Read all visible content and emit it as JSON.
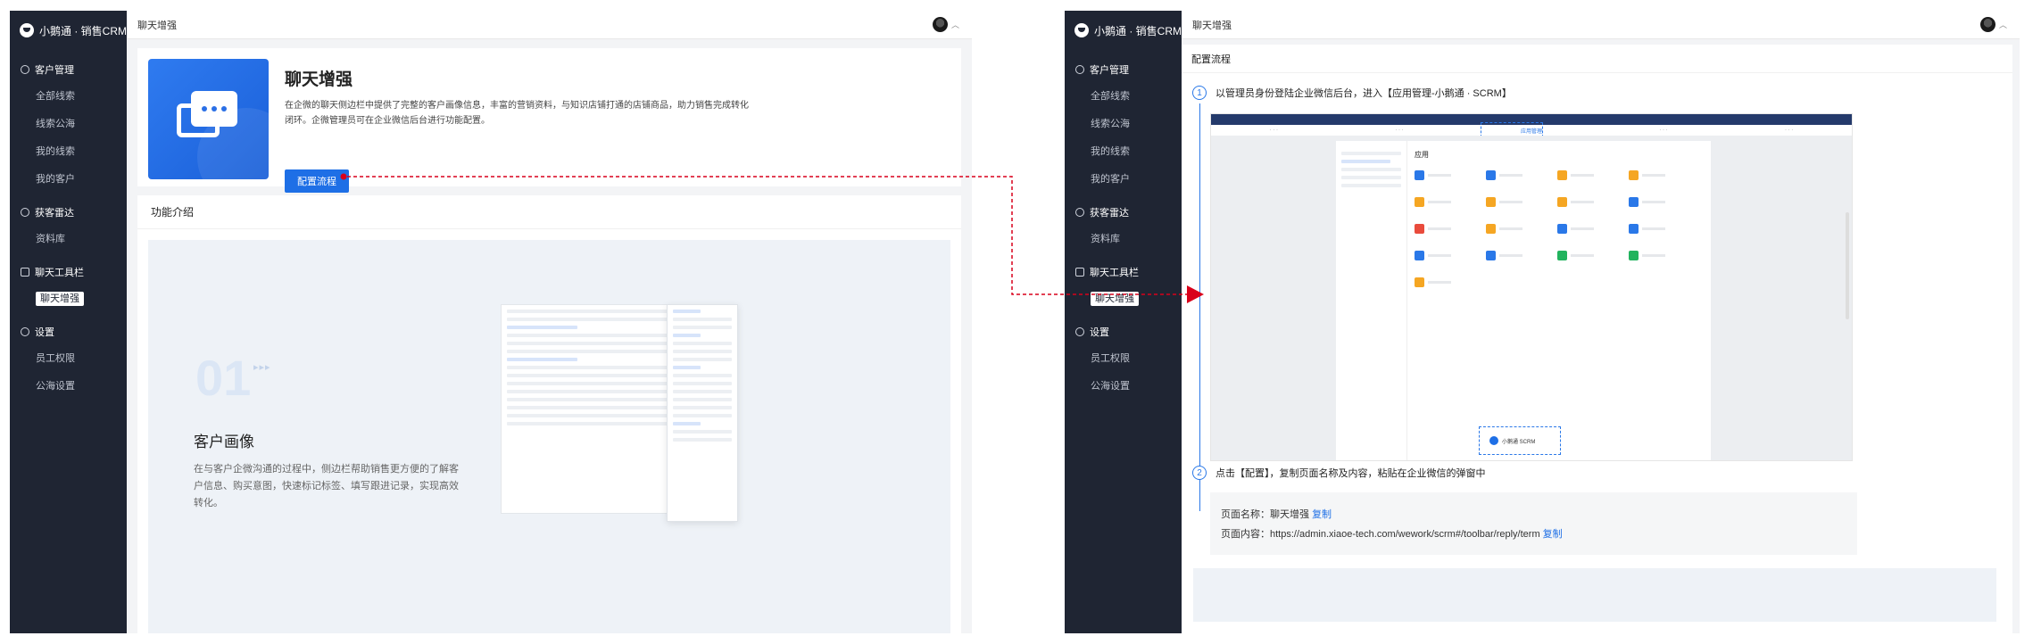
{
  "sidebar": {
    "brand": "小鹅通 · 销售CRM",
    "groups": [
      {
        "title": "客户管理",
        "items": [
          "全部线索",
          "线索公海",
          "我的线索",
          "我的客户"
        ]
      },
      {
        "title": "获客雷达",
        "items": [
          "资料库"
        ]
      },
      {
        "title": "聊天工具栏",
        "items": [
          "聊天增强"
        ]
      },
      {
        "title": "设置",
        "items": [
          "员工权限",
          "公海设置"
        ]
      }
    ],
    "active_item": "聊天增强"
  },
  "left": {
    "topbar_title": "聊天增强",
    "hero": {
      "title": "聊天增强",
      "desc": "在企微的聊天侧边栏中提供了完整的客户画像信息，丰富的营销资料，与知识店铺打通的店铺商品，助力销售完成转化闭环。企微管理员可在企业微信后台进行功能配置。",
      "button": "配置流程"
    },
    "feature": {
      "section_title": "功能介绍",
      "number": "01",
      "name": "客户画像",
      "desc": "在与客户企微沟通的过程中，侧边栏帮助销售更方便的了解客户信息、购买意图，快速标记标签、填写跟进记录，实现高效转化。"
    }
  },
  "right": {
    "topbar_title": "聊天增强",
    "config_title": "配置流程",
    "step1": {
      "num": "1",
      "text": "以管理员身份登陆企业微信后台，进入【应用管理-小鹅通 · SCRM】"
    },
    "step2": {
      "num": "2",
      "text": "点击【配置】，复制页面名称及内容，粘贴在企业微信的弹窗中"
    },
    "admin_shot": {
      "tab_active": "应用管理",
      "section": "应用",
      "highlight_app": "小鹅通 SCRM"
    },
    "page_name_label": "页面名称：",
    "page_name_value": "聊天增强",
    "page_content_label": "页面内容：",
    "page_content_value": "https://admin.xiaoe-tech.com/wework/scrm#/toolbar/reply/term",
    "copy_label": "复制"
  },
  "colors": {
    "accent": "#1e6fe6",
    "sidebar_bg": "#1f2533",
    "connector": "#d9001b"
  }
}
